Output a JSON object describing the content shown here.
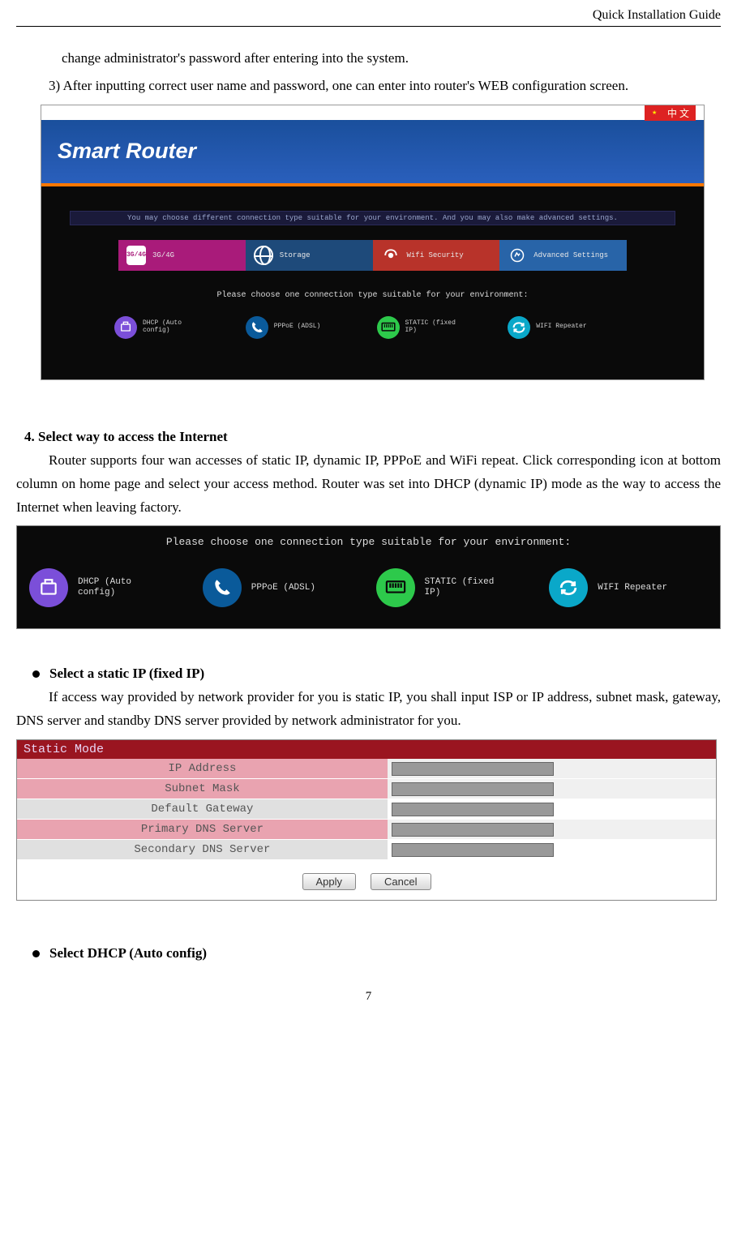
{
  "header": {
    "docTitle": "Quick Installation Guide"
  },
  "intro": {
    "line1": "change administrator's password after entering into the system.",
    "line2": "3) After inputting correct user name and password, one can enter into router's WEB configuration screen."
  },
  "ss1": {
    "langLabel": "中 文",
    "title": "Smart Router",
    "banner": "You may choose different connection type suitable for your environment. And you may also make advanced settings.",
    "tabs": {
      "t1": "3G/4G",
      "t1icon": "3G/4G",
      "t2": "Storage",
      "t3": "Wifi Security",
      "t4": "Advanced Settings"
    },
    "pleaseChoose": "Please choose one connection type suitable for your environment:",
    "conn": {
      "dhcp": "DHCP (Auto\nconfig)",
      "pppoe": "PPPoE (ADSL)",
      "static": "STATIC (fixed\nIP)",
      "repeater": "WIFI Repeater"
    }
  },
  "section4": {
    "heading": "4. Select way to access the Internet",
    "para": "Router supports four wan accesses of static IP, dynamic IP, PPPoE and WiFi repeat. Click corresponding icon at bottom column on home page and select your access method. Router was set into DHCP (dynamic IP)    mode as the way to access the Internet when leaving factory."
  },
  "ss2": {
    "title": "Please choose one connection type suitable for your environment:",
    "dhcp": "DHCP (Auto\nconfig)",
    "pppoe": "PPPoE (ADSL)",
    "static": "STATIC (fixed\nIP)",
    "repeater": "WIFI Repeater"
  },
  "bulletStatic": {
    "heading": "Select a static IP (fixed IP)",
    "para": "If access way provided by network provider for you is static IP,    you shall input ISP or IP address, subnet mask, gateway, DNS server and standby DNS server provided by network administrator for you."
  },
  "ss3": {
    "header": "Static Mode",
    "rows": {
      "r1": "IP Address",
      "r2": "Subnet Mask",
      "r3": "Default Gateway",
      "r4": "Primary DNS Server",
      "r5": "Secondary DNS Server"
    },
    "apply": "Apply",
    "cancel": "Cancel"
  },
  "bulletDhcp": {
    "heading": "Select DHCP (Auto config)"
  },
  "pageNum": "7"
}
